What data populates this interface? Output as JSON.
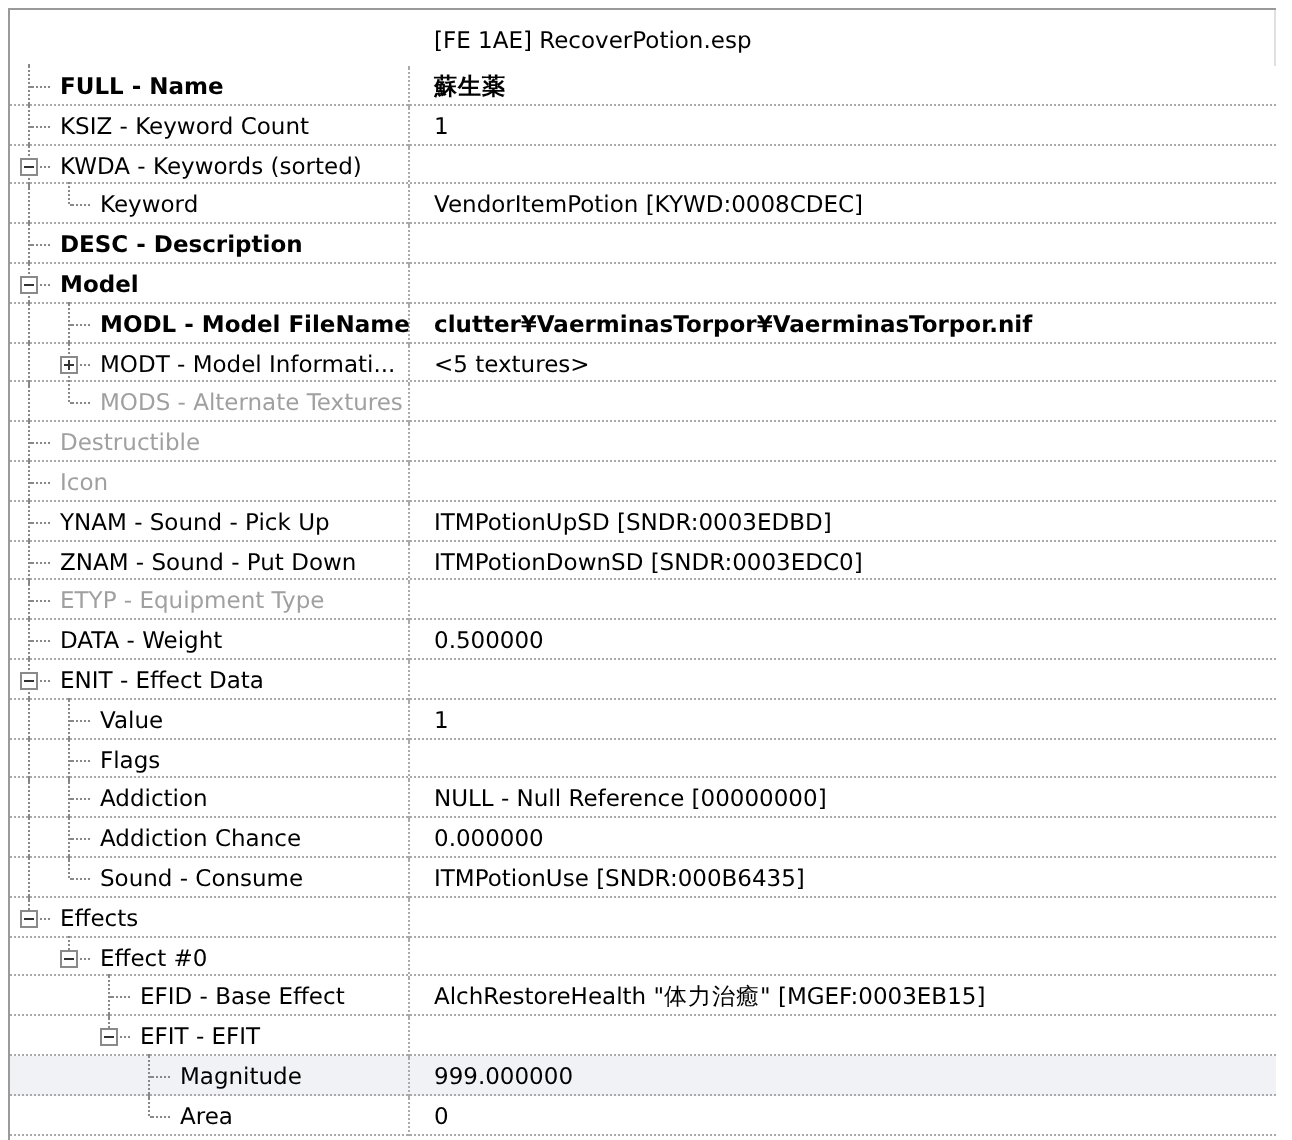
{
  "header": {
    "column_2": "[FE 1AE] RecoverPotion.esp"
  },
  "rows": [
    {
      "label": "FULL - Name",
      "value": "蘇生薬",
      "bold": true,
      "disabled": false,
      "selected": false
    },
    {
      "label": "KSIZ - Keyword Count",
      "value": "1",
      "bold": false,
      "disabled": false,
      "selected": false
    },
    {
      "label": "KWDA - Keywords (sorted)",
      "bold": false,
      "disabled": false,
      "selected": false,
      "expanded": true,
      "children": [
        {
          "label": "Keyword",
          "value": "VendorItemPotion [KYWD:0008CDEC]",
          "bold": false,
          "disabled": false,
          "selected": false
        }
      ]
    },
    {
      "label": "DESC - Description",
      "bold": true,
      "disabled": false,
      "selected": false
    },
    {
      "label": "Model",
      "bold": true,
      "disabled": false,
      "selected": false,
      "expanded": true,
      "children": [
        {
          "label": "MODL - Model FileName",
          "value": "clutter¥VaerminasTorpor¥VaerminasTorpor.nif",
          "bold": true,
          "disabled": false,
          "selected": false
        },
        {
          "label": "MODT - Model Informati...",
          "value": "<5 textures>",
          "bold": false,
          "disabled": false,
          "selected": false,
          "expanded": false
        },
        {
          "label": "MODS - Alternate Textures",
          "bold": false,
          "disabled": true,
          "selected": false
        }
      ]
    },
    {
      "label": "Destructible",
      "bold": false,
      "disabled": true,
      "selected": false
    },
    {
      "label": "Icon",
      "bold": false,
      "disabled": true,
      "selected": false
    },
    {
      "label": "YNAM - Sound - Pick Up",
      "value": "ITMPotionUpSD [SNDR:0003EDBD]",
      "bold": false,
      "disabled": false,
      "selected": false
    },
    {
      "label": "ZNAM - Sound - Put Down",
      "value": "ITMPotionDownSD [SNDR:0003EDC0]",
      "bold": false,
      "disabled": false,
      "selected": false
    },
    {
      "label": "ETYP - Equipment Type",
      "bold": false,
      "disabled": true,
      "selected": false
    },
    {
      "label": "DATA - Weight",
      "value": "0.500000",
      "bold": false,
      "disabled": false,
      "selected": false
    },
    {
      "label": "ENIT - Effect Data",
      "bold": false,
      "disabled": false,
      "selected": false,
      "expanded": true,
      "children": [
        {
          "label": "Value",
          "value": "1",
          "bold": false,
          "disabled": false,
          "selected": false
        },
        {
          "label": "Flags",
          "bold": false,
          "disabled": false,
          "selected": false
        },
        {
          "label": "Addiction",
          "value": "NULL - Null Reference [00000000]",
          "bold": false,
          "disabled": false,
          "selected": false
        },
        {
          "label": "Addiction Chance",
          "value": "0.000000",
          "bold": false,
          "disabled": false,
          "selected": false
        },
        {
          "label": "Sound - Consume",
          "value": "ITMPotionUse [SNDR:000B6435]",
          "bold": false,
          "disabled": false,
          "selected": false
        }
      ]
    },
    {
      "label": "Effects",
      "bold": false,
      "disabled": false,
      "selected": false,
      "expanded": true,
      "children": [
        {
          "label": "Effect #0",
          "bold": false,
          "disabled": false,
          "selected": false,
          "expanded": true,
          "children": [
            {
              "label": "EFID - Base Effect",
              "value": "AlchRestoreHealth \"体力治癒\" [MGEF:0003EB15]",
              "bold": false,
              "disabled": false,
              "selected": false
            },
            {
              "label": "EFIT - EFIT",
              "bold": false,
              "disabled": false,
              "selected": false,
              "expanded": true,
              "children": [
                {
                  "label": "Magnitude",
                  "value": "999.000000",
                  "bold": false,
                  "disabled": false,
                  "selected": true
                },
                {
                  "label": "Area",
                  "value": "0",
                  "bold": false,
                  "disabled": false,
                  "selected": false
                }
              ]
            }
          ]
        }
      ]
    }
  ]
}
